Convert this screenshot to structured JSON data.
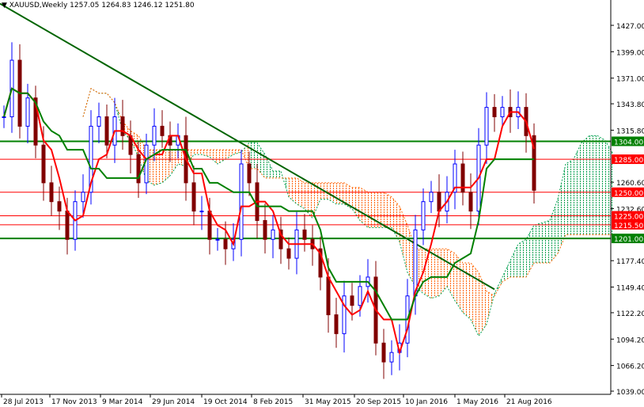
{
  "header": {
    "symbol": "XAUUSD,Weekly",
    "ohlc": "1257.05 1264.83 1246.12 1251.80"
  },
  "chart_data": {
    "type": "candlestick",
    "title": "XAUUSD,Weekly",
    "ylim": [
      1039.0,
      1427.0
    ],
    "y_ticks": [
      "1427.00",
      "1399.00",
      "1371.00",
      "1343.80",
      "1315.80",
      "1260.60",
      "1232.60",
      "1177.40",
      "1149.40",
      "1122.20",
      "1094.20",
      "1066.20",
      "1039.00"
    ],
    "x_ticks": [
      "28 Jul 2013",
      "17 Nov 2013",
      "9 Mar 2014",
      "29 Jun 2014",
      "19 Oct 2014",
      "8 Feb 2015",
      "31 May 2015",
      "20 Sep 2015",
      "10 Jan 2016",
      "1 May 2016",
      "21 Aug 2016"
    ],
    "closes": [
      1330,
      1390,
      1320,
      1350,
      1300,
      1260,
      1240,
      1230,
      1200,
      1240,
      1250,
      1320,
      1330,
      1300,
      1330,
      1310,
      1290,
      1260,
      1300,
      1320,
      1310,
      1300,
      1310,
      1260,
      1230,
      1230,
      1200,
      1200,
      1190,
      1200,
      1280,
      1260,
      1220,
      1200,
      1210,
      1190,
      1180,
      1210,
      1200,
      1190,
      1160,
      1120,
      1100,
      1140,
      1130,
      1150,
      1160,
      1090,
      1070,
      1080,
      1090,
      1140,
      1210,
      1240,
      1250,
      1230,
      1250,
      1280,
      1250,
      1230,
      1300,
      1340,
      1330,
      1340,
      1330,
      1340,
      1310,
      1252
    ],
    "levels": [
      {
        "label": "1304.00",
        "value": 1304.0,
        "color": "#008000"
      },
      {
        "label": "1285.00",
        "value": 1285.0,
        "color": "#ff0000"
      },
      {
        "label": "1250.00",
        "value": 1250.0,
        "color": "#ff0000"
      },
      {
        "label": "1225.00",
        "value": 1225.0,
        "color": "#ff0000"
      },
      {
        "label": "1215.50",
        "value": 1215.5,
        "color": "#ff0000"
      },
      {
        "label": "1201.00",
        "value": 1201.0,
        "color": "#008000"
      }
    ],
    "trendline": {
      "from": 1450,
      "to": 1147,
      "color": "#006400"
    },
    "colors": {
      "bull": "#0000ff",
      "bear": "#800000",
      "tenkan": "#ff0000",
      "kijun": "#008000",
      "cloud_bear": "#ff6600",
      "cloud_bull": "#00a050"
    }
  }
}
